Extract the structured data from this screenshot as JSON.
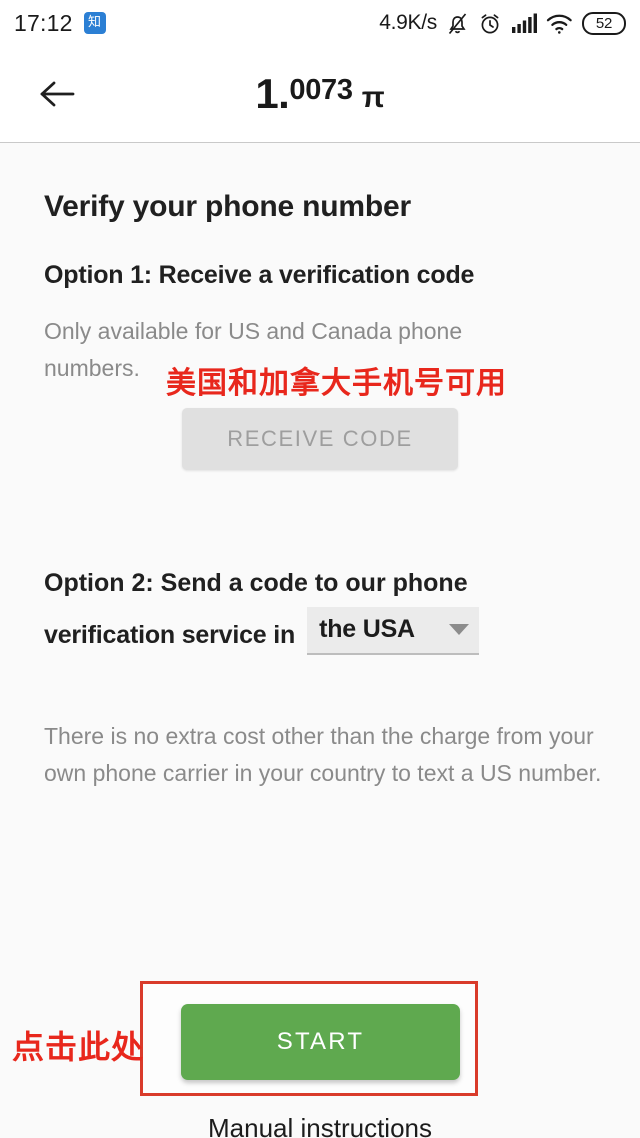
{
  "status_bar": {
    "time": "17:12",
    "app_badge": "知",
    "network_speed": "4.9K/s",
    "icons": [
      "bell-muted-icon",
      "alarm-clock-icon",
      "signal-bars-icon",
      "wifi-icon"
    ],
    "battery_level": "52"
  },
  "header": {
    "back_icon": "back-arrow-icon",
    "title_integer": "1.",
    "title_decimals": "0073",
    "title_symbol": "π"
  },
  "main": {
    "page_title": "Verify your phone number",
    "option1": {
      "heading": "Option 1: Receive a verification code",
      "note": "Only available for US and Canada phone numbers.",
      "annotation_cn": "美国和加拿大手机号可用",
      "button_label": "RECEIVE CODE",
      "button_state": "disabled"
    },
    "option2": {
      "heading_line1": "Option 2: Send a code to our phone",
      "heading_line2": "verification service in",
      "country_value": "the USA",
      "caret_icon": "chevron-down-icon",
      "note": "There is no extra cost other than the charge from your own phone carrier in your country to text a US number.",
      "start_label": "START",
      "annotation_cn": "点击此处",
      "manual_link": "Manual instructions"
    }
  },
  "colors": {
    "accent_green": "#5fa94f",
    "annotation_red": "#e8271c",
    "highlight_box_red": "#d93b2b",
    "muted_text": "#8a8a8a",
    "disabled_button": "#e0e0e0",
    "page_background": "#fafafa"
  },
  "watermark": ""
}
